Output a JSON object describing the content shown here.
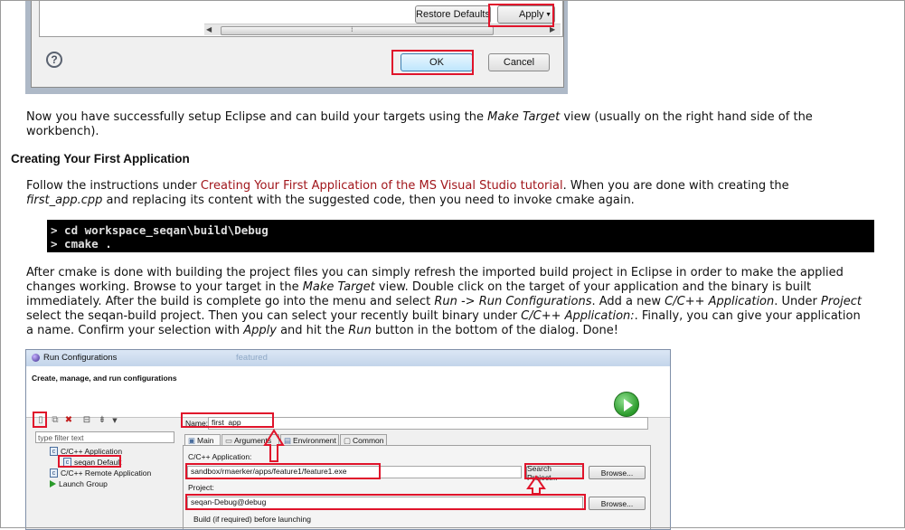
{
  "top_dialog": {
    "restore_defaults_label": "Restore Defaults",
    "apply_label": "Apply",
    "ok_label": "OK",
    "cancel_label": "Cancel",
    "help_glyph": "?"
  },
  "para1": {
    "text1": "Now you have successfully setup Eclipse and can build your targets using the ",
    "em1": "Make Target",
    "text2": " view (usually on the right hand side of the",
    "line2": "workbench)."
  },
  "heading": "Creating Your First Application",
  "para2": {
    "text1": "Follow the instructions under ",
    "link": "Creating Your First Application of the MS Visual Studio tutorial",
    "text2": ". When you are done with creating the",
    "em1": "first_app.cpp",
    "text3": " and replacing its content with the suggested code, then you need to invoke cmake again."
  },
  "code_lines": [
    "> cd workspace_seqan\\build\\Debug",
    "> cmake ."
  ],
  "para3": {
    "l1": "After cmake is done with building the project files you can simply refresh the imported build project in Eclipse in order to make the applied",
    "l2a": "changes working. Browse to your target in the ",
    "l2em": "Make Target",
    "l2b": " view. Double click on the target of your application and the binary is built",
    "l3a": "immediately. After the build is complete go into the menu and select ",
    "l3em1": "Run -> Run Configurations",
    "l3b": ". Add a new ",
    "l3em2": "C/C++ Application",
    "l3c": ". Under ",
    "l3em3": "Project",
    "l4a": "select the seqan-build project. Then you can select your recently built binary under ",
    "l4em": "C/C++ Application:",
    "l4b": ". Finally, you can give your application",
    "l5a": "a name. Confirm your selection with ",
    "l5em1": "Apply",
    "l5b": " and hit the ",
    "l5em2": "Run",
    "l5c": " button in the bottom of the dialog. Done!"
  },
  "run_config": {
    "window_title": "Run Configurations",
    "faded_title": "featured",
    "header_title": "Create, manage, and run configurations",
    "filter_placeholder": "type filter text",
    "tree": {
      "cpp_application": "C/C++ Application",
      "seqan_default": "seqan Default",
      "cpp_remote_application": "C/C++ Remote Application",
      "launch_group": "Launch Group"
    },
    "name_label": "Name:",
    "name_value": "first_app",
    "tabs": [
      "Main",
      "Arguments",
      "Environment",
      "Common"
    ],
    "app_label": "C/C++ Application:",
    "app_value": "sandbox/rmaerker/apps/feature1/feature1.exe",
    "search_project_label": "Search Project...",
    "browse_label": "Browse...",
    "project_label": "Project:",
    "project_value": "seqan-Debug@debug",
    "browse2_label": "Browse...",
    "build_label": "Build (if required) before launching"
  },
  "colors": {
    "highlight": "#e0142b",
    "link": "#a1161b",
    "run_button": "#2a9a2a"
  }
}
